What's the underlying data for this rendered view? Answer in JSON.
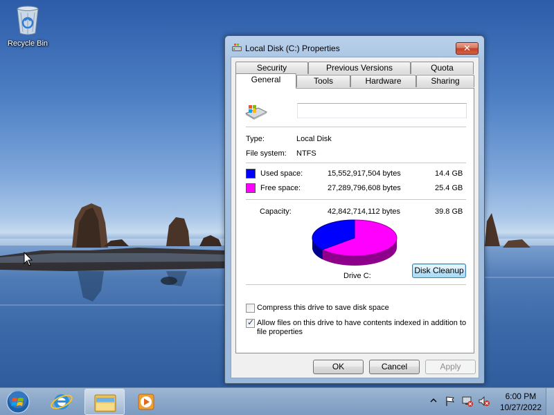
{
  "desktop": {
    "icons": [
      {
        "label": "Recycle Bin",
        "icon": "recycle-bin-icon"
      }
    ]
  },
  "window": {
    "title": "Local Disk (C:) Properties",
    "close_glyph": "✕",
    "tabs_row1": [
      "Security",
      "Previous Versions",
      "Quota"
    ],
    "tabs_row2": [
      "General",
      "Tools",
      "Hardware",
      "Sharing"
    ],
    "active_tab": "General",
    "general": {
      "volume_label_value": "",
      "type_label": "Type:",
      "type_value": "Local Disk",
      "fs_label": "File system:",
      "fs_value": "NTFS",
      "used_label": "Used space:",
      "used_bytes": "15,552,917,504 bytes",
      "used_gb": "14.4 GB",
      "free_label": "Free space:",
      "free_bytes": "27,289,796,608 bytes",
      "free_gb": "25.4 GB",
      "capacity_label": "Capacity:",
      "capacity_bytes": "42,842,714,112 bytes",
      "capacity_gb": "39.8 GB",
      "drive_label": "Drive C:",
      "disk_cleanup": "Disk Cleanup",
      "compress_label": "Compress this drive to save disk space",
      "compress_checked": false,
      "index_label": "Allow files on this drive to have contents indexed in addition to file properties",
      "index_checked": true,
      "used_fraction": 0.363
    },
    "buttons": {
      "ok": "OK",
      "cancel": "Cancel",
      "apply": "Apply"
    },
    "colors": {
      "used": "#0000ff",
      "free": "#ff00ff"
    }
  },
  "taskbar": {
    "items": [
      "start-orb-icon",
      "internet-explorer-icon",
      "windows-explorer-icon",
      "media-player-icon"
    ],
    "tray": [
      "show-hidden-icons-chevron",
      "action-center-flag-icon",
      "network-icon",
      "volume-muted-icon"
    ],
    "time": "6:00 PM",
    "date": "10/27/2022"
  }
}
